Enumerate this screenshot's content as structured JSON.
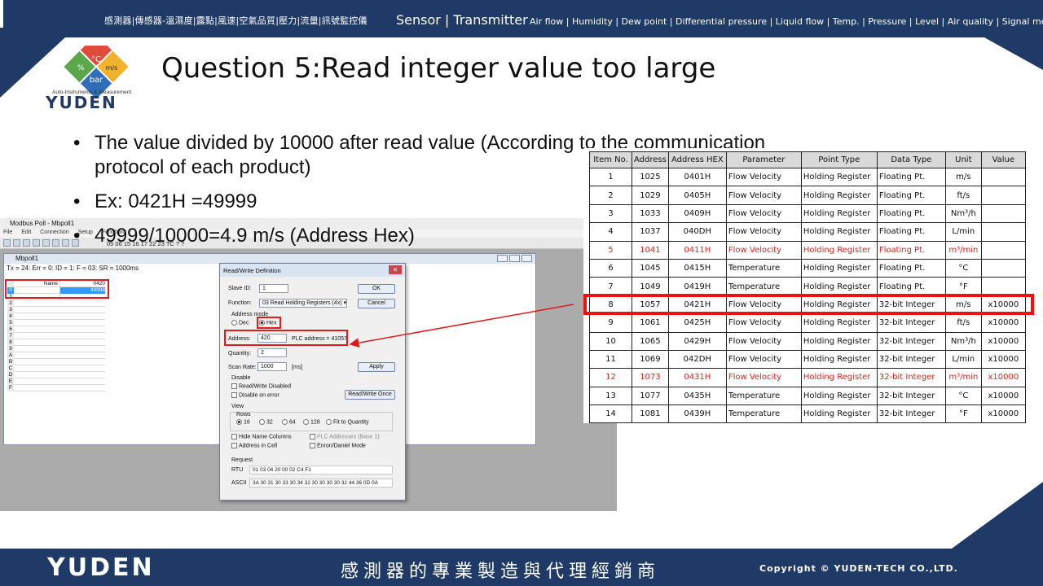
{
  "header": {
    "cn_categories": "感測器|傳感器-溫濕度|露點|風速|空氣品質|壓力|流量|訊號監控儀",
    "en_main": "Sensor | Transmitter",
    "en_categories": "Air flow | Humidity | Dew point | Differential pressure | Liquid flow | Temp. | Pressure | Level | Air quality | Signal meter"
  },
  "logo": {
    "units": [
      "%",
      "°C",
      "m/s",
      "bar"
    ],
    "tagline": "Auto-Instruments & Measurement",
    "brand": "YUDEN"
  },
  "slide": {
    "title": "Question 5:Read integer value too large",
    "bullet1_line1": "The value divided by 10000 after read value (According to the communication",
    "bullet1_line2": "protocol of each product)",
    "bullet2": "Ex: 0421H =49999",
    "bullet3": "49999/10000=4.9 m/s  (Address Hex)"
  },
  "modbus_app": {
    "title": "Modbus Poll - Mbpoll1",
    "menu": [
      "File",
      "Edit",
      "Connection",
      "Setup",
      "Functions"
    ],
    "toolbar_codes": "05 06 15 16 17 22 23  TC  ?  ?",
    "mdi_title": "Mbpoll1",
    "status": "Tx = 24: Err = 0: ID = 1: F = 03: SR = 1000ms",
    "grid_header_name": "Name",
    "grid_header_addr": "0420",
    "row_labels": [
      "0",
      "1",
      "2",
      "3",
      "4",
      "5",
      "6",
      "7",
      "8",
      "9",
      "A",
      "B",
      "C",
      "D",
      "E",
      "F"
    ],
    "row0_value": "49998",
    "row1_value": "..."
  },
  "dialog": {
    "title": "Read/Write Definition",
    "slave_id_label": "Slave ID:",
    "slave_id_value": "1",
    "function_label": "Function:",
    "function_value": "03 Read Holding Registers (4x)",
    "address_mode_label": "Address mode",
    "mode_dec": "Dec",
    "mode_hex": "Hex",
    "address_label": "Address:",
    "address_value": "420",
    "plc_address": "PLC address = 41057",
    "quantity_label": "Quantity:",
    "quantity_value": "2",
    "scan_rate_label": "Scan Rate:",
    "scan_rate_value": "1000",
    "scan_rate_unit": "[ms]",
    "ok": "OK",
    "cancel": "Cancel",
    "apply": "Apply",
    "disable_label": "Disable",
    "rw_disabled": "Read/Write Disabled",
    "disable_on_error": "Disable on error",
    "rw_once": "Read/Write Once",
    "view_label": "View",
    "rows_label": "Rows",
    "rows_options": [
      "16",
      "32",
      "64",
      "128",
      "Fit to Quantity"
    ],
    "hide_names": "Hide Name Columns",
    "plc_addresses": "PLC Addresses (Base 1)",
    "address_in_cell": "Address in Cell",
    "enron": "Enron/Daniel Mode",
    "request_label": "Request",
    "rtu_label": "RTU",
    "rtu_value": "01 03 04 20 00 02 C4 F1",
    "ascii_label": "ASCII",
    "ascii_value": "3A 30 31 30 33 30 34 32 30 30 30 30 32 44 36 0D 0A"
  },
  "table": {
    "headers": [
      "Item No.",
      "Address",
      "Address HEX",
      "Parameter",
      "Point Type",
      "Data Type",
      "Unit",
      "Value"
    ],
    "rows": [
      [
        "1",
        "1025",
        "0401H",
        "Flow Velocity",
        "Holding Register",
        "Floating Pt.",
        "m/s",
        ""
      ],
      [
        "2",
        "1029",
        "0405H",
        "Flow Velocity",
        "Holding Register",
        "Floating Pt.",
        "ft/s",
        ""
      ],
      [
        "3",
        "1033",
        "0409H",
        "Flow Velocity",
        "Holding Register",
        "Floating Pt.",
        "Nm³/h",
        ""
      ],
      [
        "4",
        "1037",
        "040DH",
        "Flow Velocity",
        "Holding Register",
        "Floating Pt.",
        "L/min",
        ""
      ],
      [
        "5",
        "1041",
        "0411H",
        "Flow Velocity",
        "Holding Register",
        "Floating Pt.",
        "m³/min",
        ""
      ],
      [
        "6",
        "1045",
        "0415H",
        "Temperature",
        "Holding Register",
        "Floating Pt.",
        "°C",
        ""
      ],
      [
        "7",
        "1049",
        "0419H",
        "Temperature",
        "Holding Register",
        "Floating Pt.",
        "°F",
        ""
      ],
      [
        "8",
        "1057",
        "0421H",
        "Flow Velocity",
        "Holding Register",
        "32-bit Integer",
        "m/s",
        "x10000"
      ],
      [
        "9",
        "1061",
        "0425H",
        "Flow Velocity",
        "Holding Register",
        "32-bit Integer",
        "ft/s",
        "x10000"
      ],
      [
        "10",
        "1065",
        "0429H",
        "Flow Velocity",
        "Holding Register",
        "32-bit Integer",
        "Nm³/h",
        "x10000"
      ],
      [
        "11",
        "1069",
        "042DH",
        "Flow Velocity",
        "Holding Register",
        "32-bit Integer",
        "L/min",
        "x10000"
      ],
      [
        "12",
        "1073",
        "0431H",
        "Flow Velocity",
        "Holding Register",
        "32-bit Integer",
        "m³/min",
        "x10000"
      ],
      [
        "13",
        "1077",
        "0435H",
        "Temperature",
        "Holding Register",
        "32-bit Integer",
        "°C",
        "x10000"
      ],
      [
        "14",
        "1081",
        "0439H",
        "Temperature",
        "Holding Register",
        "32-bit Integer",
        "°F",
        "x10000"
      ]
    ],
    "red_rows": [
      4,
      11
    ],
    "highlight_row": 7
  },
  "footer": {
    "brand": "YUDEN",
    "cn_slogan": "感測器的專業製造與代理經銷商",
    "copyright": "Copyright © YUDEN-TECH CO.,LTD."
  },
  "colors": {
    "navy": "#1f3a66",
    "highlight_red": "#ee1111",
    "red_text": "#e02020",
    "selection_blue": "#3399ff"
  }
}
